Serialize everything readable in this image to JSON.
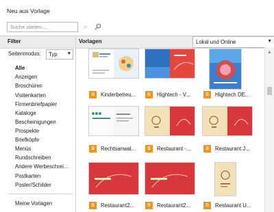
{
  "window": {
    "title": "Neu aus Vorlage"
  },
  "search": {
    "placeholder": "Suche starten..."
  },
  "filter": {
    "header": "Filter",
    "mode_label": "Seitenmodus:",
    "mode_value": "Typ",
    "categories": [
      "Alle",
      "Anzeigen",
      "Broschüren",
      "Visitenkarten",
      "Firmenbriefpapier",
      "Kataloge",
      "Bescheinigungen",
      "Prospekte",
      "Briefköpfe",
      "Menüs",
      "Rundschreiben",
      "Andere Werbeschrei...",
      "Postkarten",
      "Poster/Schilder"
    ],
    "my_templates": "Meine Vorlagen"
  },
  "main": {
    "header": "Vorlagen",
    "location": "Lokal und Online",
    "templates": [
      {
        "label": "Kinderbetreu...",
        "badge": "S"
      },
      {
        "label": "Hightech - V...",
        "badge": "S"
      },
      {
        "label": "Hightech DE...",
        "badge": "S"
      },
      {
        "label": "Rechtsanwal...",
        "badge": "S"
      },
      {
        "label": "Restaurant -...",
        "badge": "S"
      },
      {
        "label": "Restaurant J...",
        "badge": "S"
      },
      {
        "label": "Restaurant2...",
        "badge": "S"
      },
      {
        "label": "Restaurant2...",
        "badge": "S"
      },
      {
        "label": "Restaurant U...",
        "badge": "S"
      }
    ]
  },
  "colors": {
    "badge": "#f0931f",
    "restaurant_red": "#d8383c",
    "hightech_blue": "#2f6fc0"
  }
}
